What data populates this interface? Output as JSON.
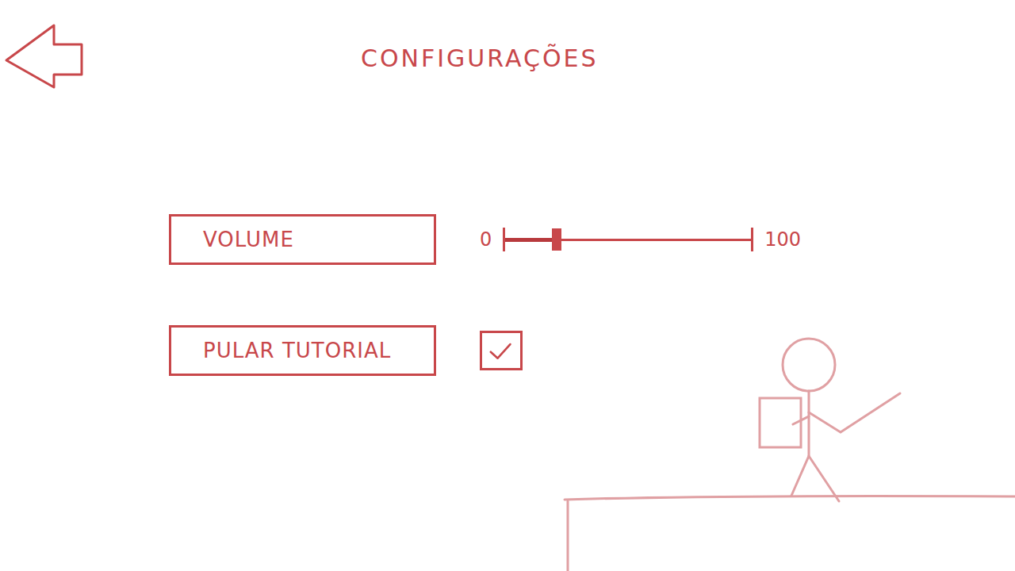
{
  "title": "CONFIGURAÇÕES",
  "settings": [
    {
      "label": "VOLUME",
      "kind": "slider",
      "level": 0.21,
      "min": "0",
      "max": "100"
    },
    {
      "label": "PULAR TUTORIAL",
      "kind": "checkbox",
      "checked": true
    }
  ]
}
